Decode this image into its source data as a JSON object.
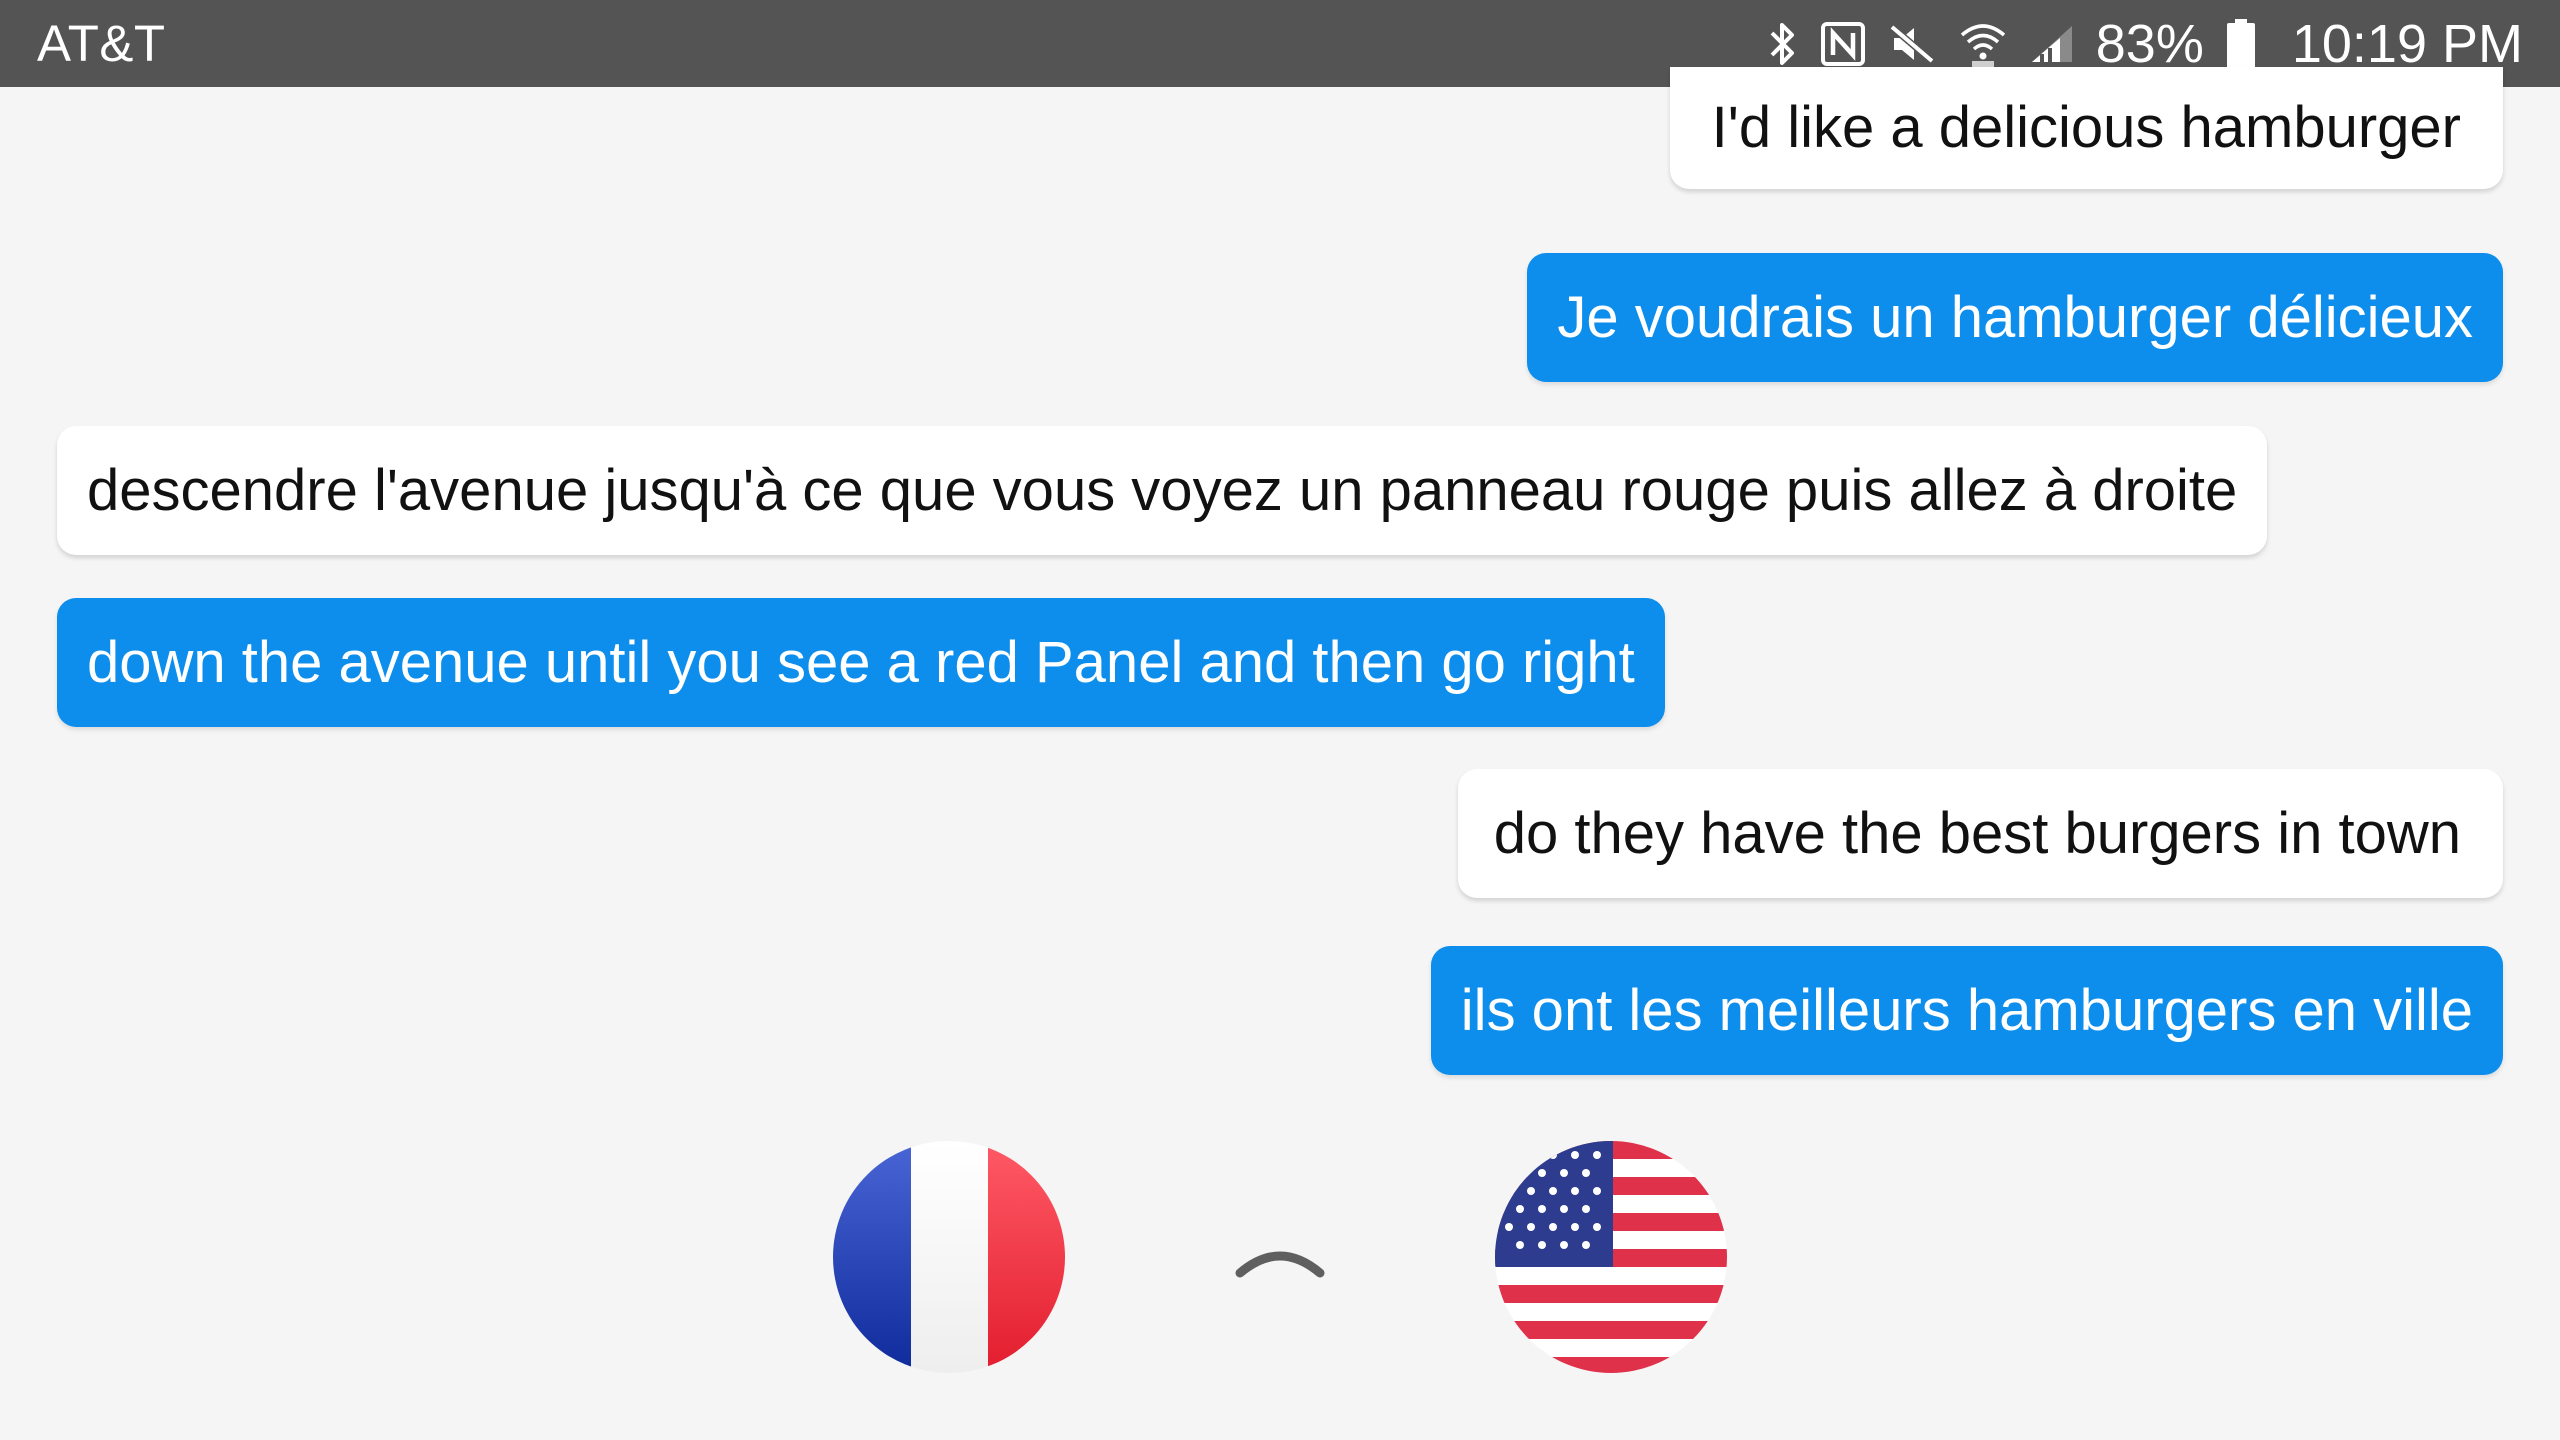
{
  "status_bar": {
    "carrier": "AT&T",
    "battery_percent": "83%",
    "time": "10:19 PM",
    "icons": [
      "bluetooth-icon",
      "nfc-icon",
      "mute-icon",
      "wifi-icon",
      "signal-icon",
      "battery-icon"
    ]
  },
  "messages": [
    {
      "text": "I'd like a delicious hamburger",
      "style": "white",
      "align": "right"
    },
    {
      "text": "Je voudrais un hamburger délicieux",
      "style": "blue",
      "align": "right"
    },
    {
      "text": "descendre l'avenue jusqu'à ce que vous voyez un panneau rouge puis allez à droite",
      "style": "white",
      "align": "left"
    },
    {
      "text": "down the avenue until you see a red Panel and then go right",
      "style": "blue",
      "align": "left"
    },
    {
      "text": "do they have the best burgers in town",
      "style": "white",
      "align": "right"
    },
    {
      "text": "ils ont les meilleurs hamburgers en ville",
      "style": "blue",
      "align": "right"
    }
  ],
  "language_bar": {
    "left_flag": "france-flag-icon",
    "swap": "chevron-up-icon",
    "right_flag": "usa-flag-icon"
  },
  "colors": {
    "status_bar_bg": "#545454",
    "page_bg": "#f5f5f5",
    "bubble_blue": "#0d8eed",
    "bubble_white": "#ffffff"
  }
}
